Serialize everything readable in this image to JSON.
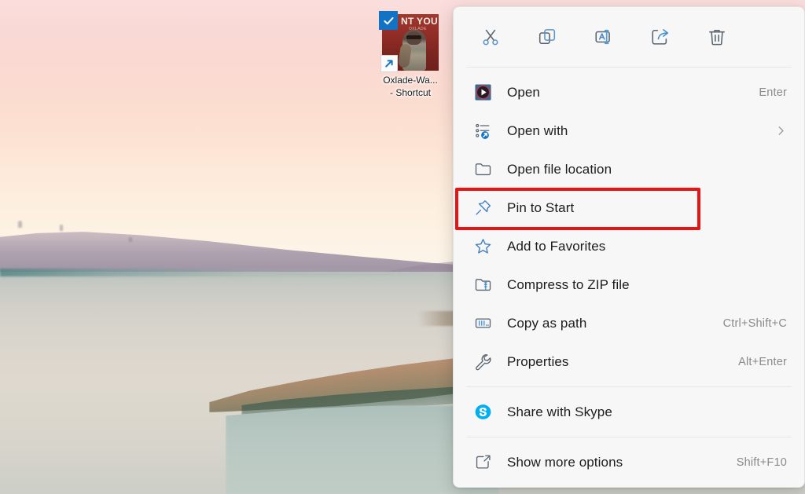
{
  "desktop": {
    "shortcut": {
      "name_line1": "Oxlade-Wa...",
      "name_line2": "- Shortcut",
      "thumbnail_title": "NT YOU",
      "thumbnail_subtitle": "OXLADE",
      "badge_sync": "check-badge",
      "badge_shortcut": "shortcut-arrow-badge"
    }
  },
  "context_menu": {
    "toolbar": [
      {
        "name": "cut",
        "icon": "scissors-icon"
      },
      {
        "name": "copy",
        "icon": "copy-icon"
      },
      {
        "name": "rename",
        "icon": "rename-icon"
      },
      {
        "name": "share",
        "icon": "share-icon"
      },
      {
        "name": "delete",
        "icon": "trash-icon"
      }
    ],
    "groups": [
      {
        "items": [
          {
            "label": "Open",
            "accel": "Enter",
            "icon": "media-player-icon",
            "submenu": false,
            "highlighted": false
          },
          {
            "label": "Open with",
            "accel": "",
            "icon": "open-with-icon",
            "submenu": true,
            "highlighted": false
          },
          {
            "label": "Open file location",
            "accel": "",
            "icon": "folder-icon",
            "submenu": false,
            "highlighted": false
          },
          {
            "label": "Pin to Start",
            "accel": "",
            "icon": "pin-icon",
            "submenu": false,
            "highlighted": true
          },
          {
            "label": "Add to Favorites",
            "accel": "",
            "icon": "star-icon",
            "submenu": false,
            "highlighted": false
          },
          {
            "label": "Compress to ZIP file",
            "accel": "",
            "icon": "zip-folder-icon",
            "submenu": false,
            "highlighted": false
          },
          {
            "label": "Copy as path",
            "accel": "Ctrl+Shift+C",
            "icon": "copy-path-icon",
            "submenu": false,
            "highlighted": false
          },
          {
            "label": "Properties",
            "accel": "Alt+Enter",
            "icon": "wrench-icon",
            "submenu": false,
            "highlighted": false
          }
        ]
      },
      {
        "items": [
          {
            "label": "Share with Skype",
            "accel": "",
            "icon": "skype-icon",
            "submenu": false,
            "highlighted": false
          }
        ]
      },
      {
        "items": [
          {
            "label": "Show more options",
            "accel": "Shift+F10",
            "icon": "more-options-icon",
            "submenu": false,
            "highlighted": false
          }
        ]
      }
    ]
  },
  "colors": {
    "accent_blue": "#1273c4",
    "highlight_red": "#e81313",
    "menu_bg": "#f7f7f7",
    "text_primary": "#1c1c1c",
    "text_secondary": "#8a8a8a",
    "skype_blue": "#00aff0"
  }
}
